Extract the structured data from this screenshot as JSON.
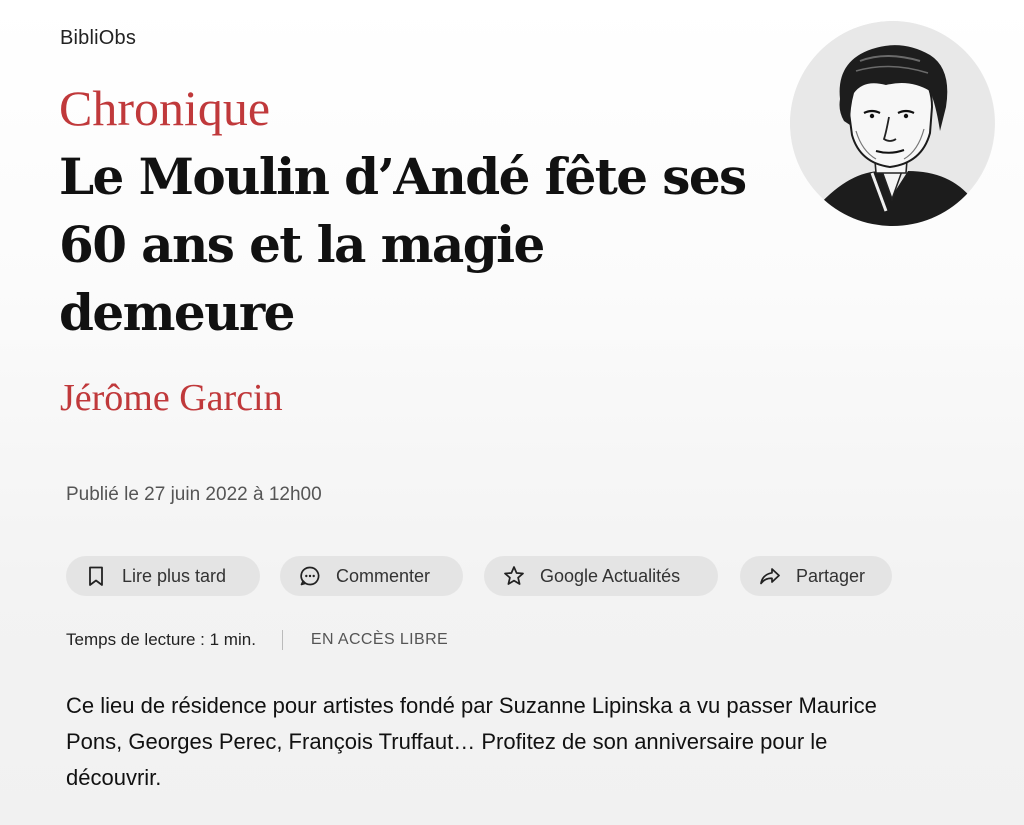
{
  "header": {
    "section": "BibliObs"
  },
  "article": {
    "rubric": "Chronique",
    "title": "Le Moulin d’Andé fête ses 60 ans et la magie demeure",
    "author": "Jérôme Garcin",
    "published": "Publié le 27 juin 2022 à 12h00",
    "reading_time": "Temps de lecture : 1 min.",
    "access": "EN ACCÈS LIBRE",
    "lede": "Ce lieu de résidence pour artistes fondé par Suzanne Lipinska a vu passer Maurice Pons, Georges Perec, François Truffaut… Profitez de son anniversaire pour le découvrir."
  },
  "actions": [
    {
      "label": "Lire plus tard",
      "icon": "bookmark-icon"
    },
    {
      "label": "Commenter",
      "icon": "comment-icon"
    },
    {
      "label": "Google Actualités",
      "icon": "star-icon"
    },
    {
      "label": "Partager",
      "icon": "share-icon"
    }
  ],
  "colors": {
    "accent": "#c0393b",
    "text": "#111111",
    "muted": "#555555",
    "button_bg": "#e4e4e4"
  }
}
